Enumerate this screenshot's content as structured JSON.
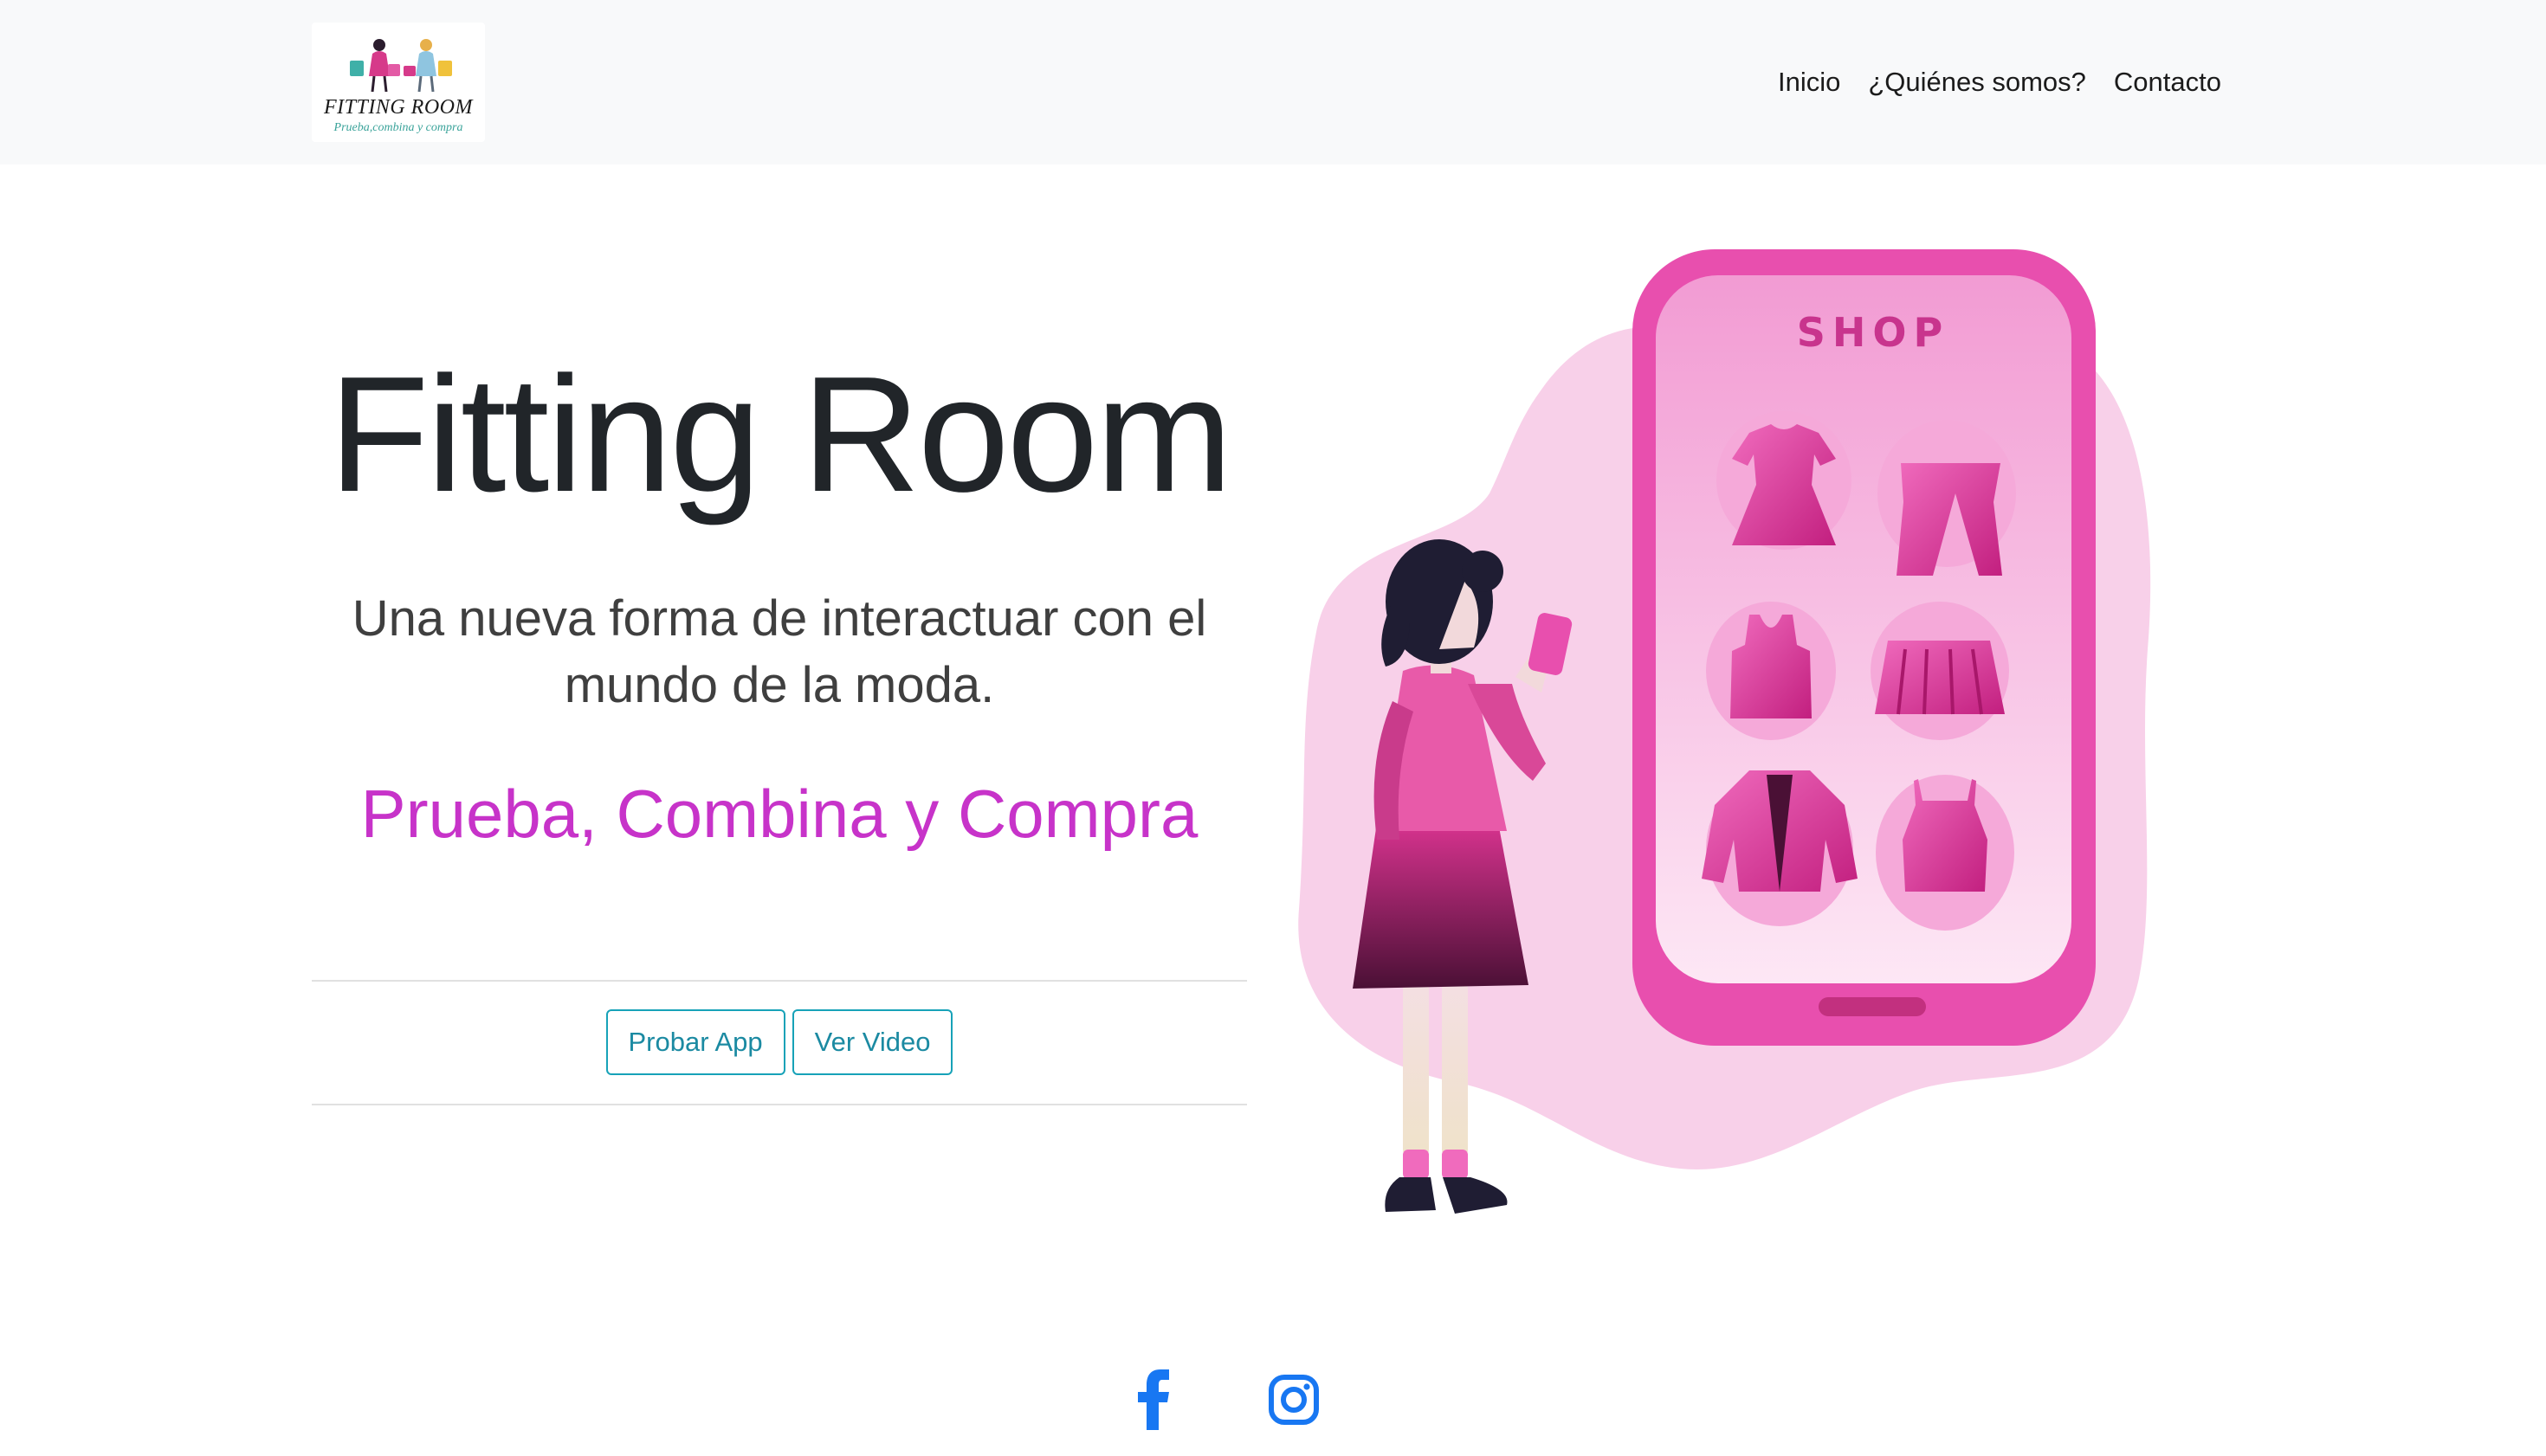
{
  "navbar": {
    "logo": {
      "title": "FITTING ROOM",
      "tagline": "Prueba,combina y compra"
    },
    "links": [
      {
        "label": "Inicio"
      },
      {
        "label": "¿Quiénes somos?"
      },
      {
        "label": "Contacto"
      }
    ]
  },
  "hero": {
    "title": "Fitting Room",
    "lead": "Una nueva forma de interactuar con el mundo de la moda.",
    "slogan": "Prueba, Combina y Compra",
    "buttons": {
      "try_app": "Probar App",
      "watch_video": "Ver Video"
    }
  },
  "illustration": {
    "phone_label": "SHOP"
  },
  "social": {
    "facebook_icon": "facebook-icon",
    "instagram_icon": "instagram-icon"
  },
  "colors": {
    "accent_pink": "#c733c9",
    "phone_pink": "#e84fae",
    "blob_pink": "#f8d0e9",
    "button_teal": "#17a2b8",
    "social_blue": "#1877f2",
    "navbar_bg": "#f8f9fa"
  }
}
